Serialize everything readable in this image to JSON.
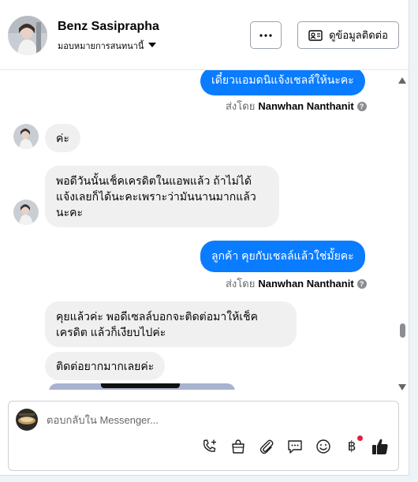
{
  "header": {
    "contact_name": "Benz Sasiprapha",
    "assign_label": "มอบหมายการสนทนานี้",
    "more_label": "···",
    "contact_info_label": "ดูข้อมูลติดต่อ"
  },
  "messages": [
    {
      "id": 1,
      "direction": "outgoing",
      "text": "เดี๋ยวแอมดนิแจ้งเชลส์ให้นะคะ"
    },
    {
      "id": 2,
      "direction": "sent_by",
      "prefix": "ส่งโดย",
      "name": "Nanwhan Nanthanit"
    },
    {
      "id": 3,
      "direction": "incoming",
      "text": "ค่ะ"
    },
    {
      "id": 4,
      "direction": "incoming",
      "lines": [
        "พอดีวันนั้นเช็คเครดิตในแอพแล้ว ถ้าไม่ได้",
        "แจ้งเลยก็ได้นะคะเพราะว่ามันนานมากแล้ว",
        "นะคะ"
      ]
    },
    {
      "id": 5,
      "direction": "outgoing",
      "text": "ลูกค้า คุยกับเชลล์แล้วใช่มั้ยคะ"
    },
    {
      "id": 6,
      "direction": "sent_by",
      "prefix": "ส่งโดย",
      "name": "Nanwhan Nanthanit"
    },
    {
      "id": 7,
      "direction": "incoming",
      "lines": [
        "คุยแล้วค่ะ พอดีเซลล์บอกจะติดต่อมาให้เช็ค",
        "เครดิต แล้วก็เงียบไปค่ะ"
      ]
    },
    {
      "id": 8,
      "direction": "incoming",
      "text": "ติดต่อยากมากเลยค่ะ"
    }
  ],
  "composer": {
    "placeholder": "ตอบกลับใน Messenger...",
    "tools": [
      "phone-plus-icon",
      "shopping-bag-icon",
      "paperclip-icon",
      "saved-reply-icon",
      "emoji-icon",
      "baht-payment-icon",
      "thumbs-up-icon"
    ],
    "baht_symbol": "฿"
  },
  "colors": {
    "outgoing_bubble": "#0a7cff",
    "incoming_bubble": "#f0f0f0",
    "thumbs_up": "#1c1e21",
    "notification_dot": "#e41e3f"
  }
}
